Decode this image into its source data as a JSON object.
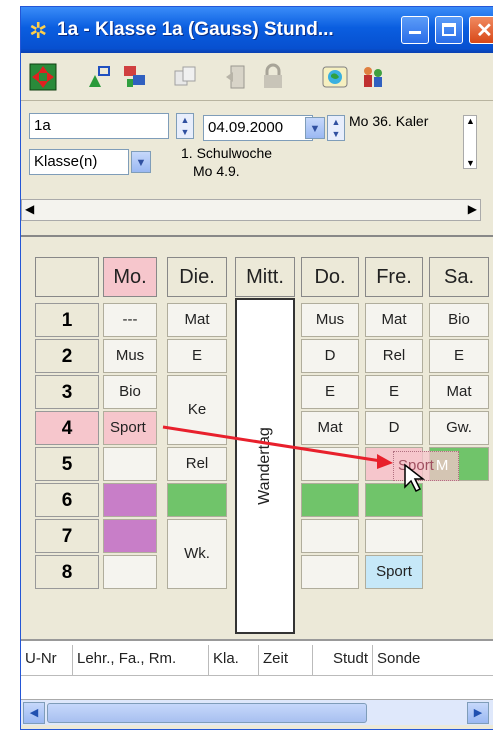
{
  "window": {
    "title": "1a - Klasse 1a (Gauss)  Stund...",
    "app_icon": "timetable-app-icon"
  },
  "toolbar": {
    "icons": [
      "navigate-icon",
      "resize-icon",
      "classes-icon",
      "copy-icon",
      "door-icon",
      "lock-icon",
      "globe-icon",
      "teacher-icon"
    ]
  },
  "nav": {
    "element_value": "1a",
    "date_value": "04.09.2000",
    "week_text": "Mo 36. Kaler",
    "type_value": "Klasse(n)",
    "school_week": "1. Schulwoche",
    "day_date": "Mo 4.9."
  },
  "timetable": {
    "days": [
      "Mo.",
      "Die.",
      "Mitt.",
      "Do.",
      "Fre.",
      "Sa."
    ],
    "periods": [
      "1",
      "2",
      "3",
      "4",
      "5",
      "6",
      "7",
      "8"
    ],
    "wandertag_label": "Wandertag",
    "cells": {
      "mo": [
        "---",
        "Mus",
        "Bio",
        "Sport",
        "",
        "",
        "",
        ""
      ],
      "die": [
        "Mat",
        "E",
        "Ke",
        "Rel",
        "Wk."
      ],
      "do": [
        "Mus",
        "D",
        "E",
        "Mat",
        "",
        "",
        "",
        ""
      ],
      "fre": [
        "Mat",
        "Rel",
        "E",
        "D",
        "Sport",
        "",
        "",
        "Sport"
      ],
      "sa": [
        "Bio",
        "E",
        "Mat",
        "Gw.",
        "M"
      ]
    },
    "colors": {
      "selected_pink": "#f6c6cc",
      "purple": "#c87ec8",
      "green": "#70c46a",
      "lightblue": "#c6e8f8",
      "arrow": "#e8202c"
    }
  },
  "list": {
    "columns": [
      "U-Nr",
      "Lehr., Fa., Rm.",
      "Kla.",
      "Zeit",
      "Studt",
      "Sonde"
    ]
  }
}
